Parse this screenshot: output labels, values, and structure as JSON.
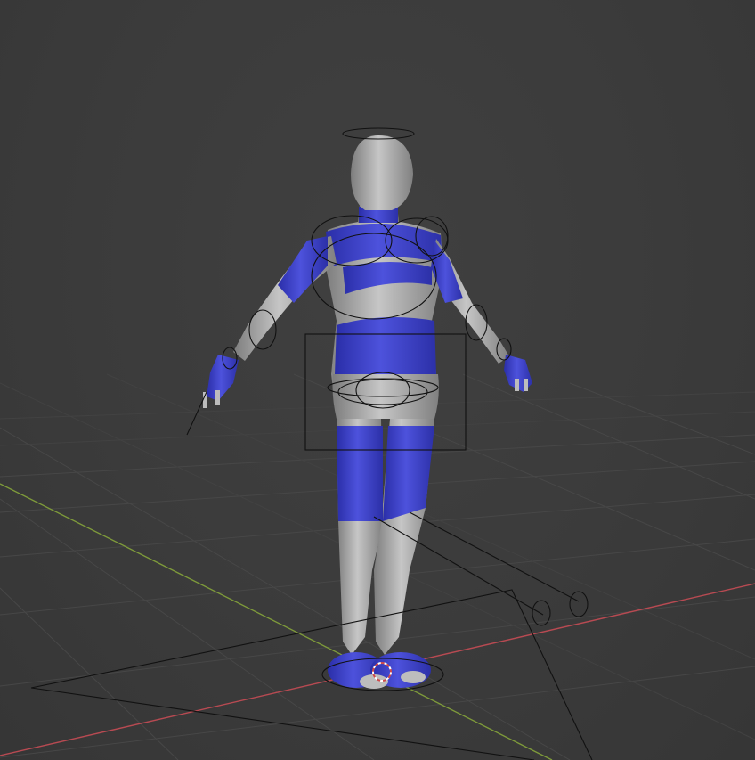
{
  "viewport": {
    "background": "#3a3a3a",
    "grid_color": "#474747",
    "axis_x_color": "#b84a52",
    "axis_y_color": "#7e9a3a"
  },
  "model": {
    "skin_color": "#a9a9a9",
    "stripe_color": "#3f43c8",
    "rig_color": "#111111",
    "origin_color": "#d04a4a"
  },
  "icons": {
    "origin": "3d-cursor-icon"
  }
}
